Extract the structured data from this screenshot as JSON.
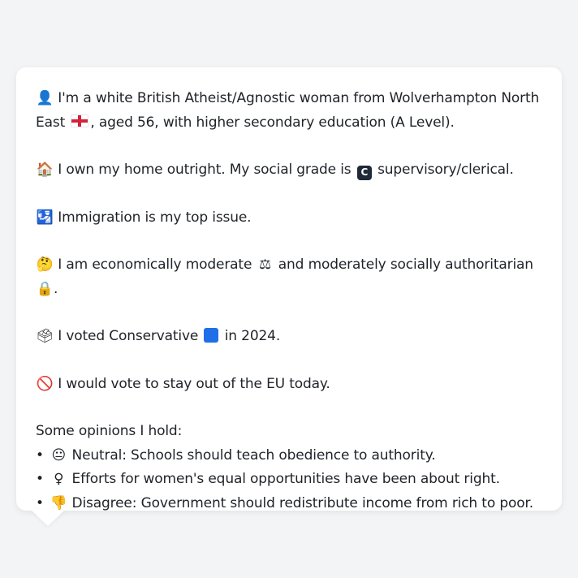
{
  "profile": {
    "line1_prefix_icon": "person-silhouette-icon",
    "line1_a": "I'm a white British Atheist/Agnostic woman from Wolverhampton North East",
    "line1_flag_icon": "england-flag-icon",
    "line1_b": ", aged 56, with higher secondary education (A Level).",
    "line2_icon": "house-icon",
    "line2_a": "I own my home outright. My social grade is",
    "line2_badge": "C",
    "line2_b": "supervisory/clerical.",
    "line3_icon": "passport-control-icon",
    "line3": "Immigration is my top issue.",
    "line4_icon": "thinking-face-icon",
    "line4_a": "I am economically moderate",
    "line4_scales_icon": "scales-icon",
    "line4_b": "and moderately socially authoritarian",
    "line4_lock_icon": "lock-icon",
    "line4_c": ".",
    "line5_icon": "ballot-box-icon",
    "line5_a": "I voted Conservative",
    "line5_square_icon": "blue-square-icon",
    "line5_b": "in 2024.",
    "line6_icon": "prohibited-icon",
    "line6": "I would vote to stay out of the EU today."
  },
  "opinions": {
    "heading": "Some opinions I hold:",
    "items": [
      {
        "icon": "neutral-face-icon",
        "text": "Neutral: Schools should teach obedience to authority."
      },
      {
        "icon": "female-sign-icon",
        "text": "Efforts for women's equal opportunities have been about right."
      },
      {
        "icon": "thumbs-down-icon",
        "text": "Disagree: Government should redistribute income from rich to poor."
      }
    ]
  },
  "colors": {
    "background": "#f3f4f6",
    "bubble": "#ffffff",
    "text": "#1f2328",
    "flag_red": "#d3223a",
    "conservative_blue": "#1f6fe8"
  }
}
